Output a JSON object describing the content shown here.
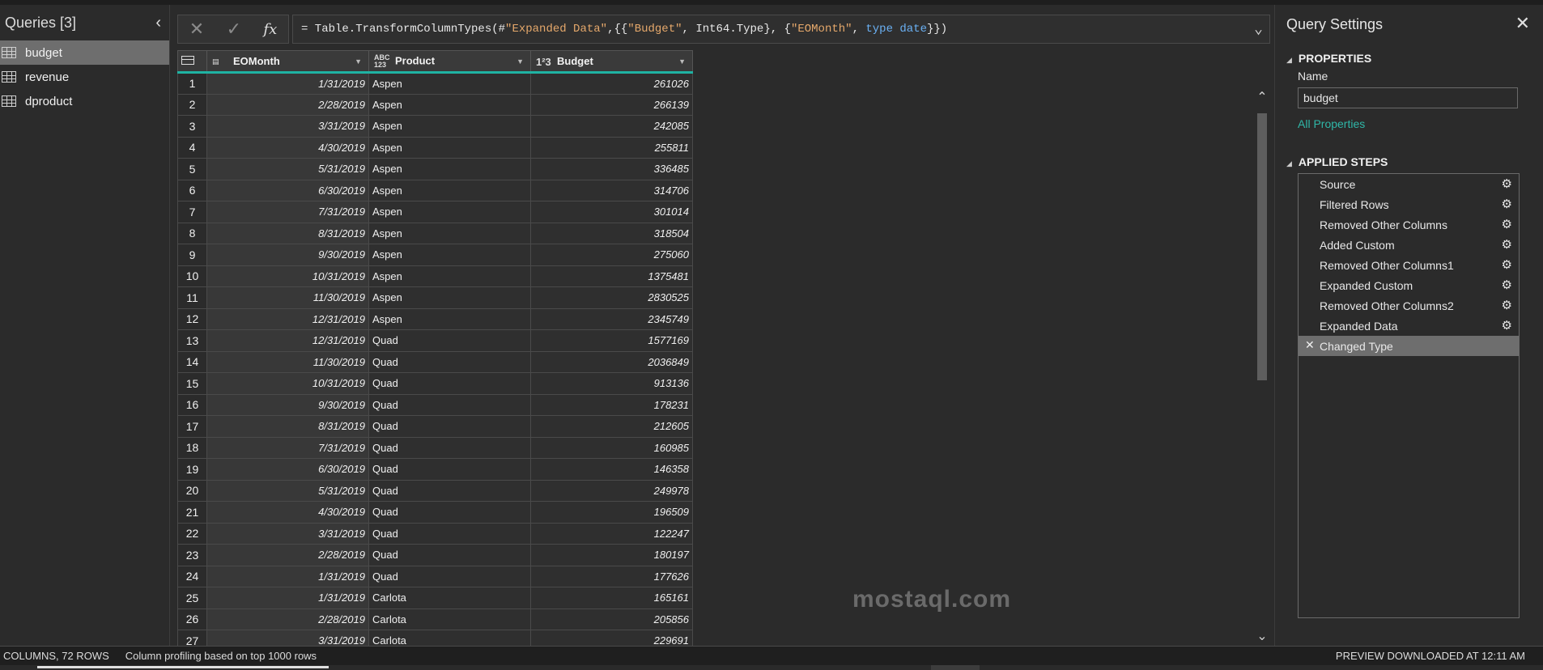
{
  "queries_panel": {
    "title": "Queries [3]",
    "items": [
      {
        "label": "budget",
        "selected": true
      },
      {
        "label": "revenue",
        "selected": false
      },
      {
        "label": "dproduct",
        "selected": false
      }
    ]
  },
  "formula_bar": {
    "prefix": "= Table.TransformColumnTypes(#",
    "s1": "\"Expanded Data\"",
    "p2": ",{{",
    "s2": "\"Budget\"",
    "p3": ", Int64.Type}, {",
    "s3": "\"EOMonth\"",
    "p4": ", ",
    "k1": "type date",
    "p5": "}})",
    "fx_label": "fx"
  },
  "table": {
    "columns": [
      {
        "name": "EOMonth",
        "type_icon": "calendar-icon"
      },
      {
        "name": "Product",
        "type_icon": "ABC 123"
      },
      {
        "name": "Budget",
        "type_icon": "1²3"
      }
    ],
    "rows": [
      [
        "1",
        "1/31/2019",
        "Aspen",
        "261026"
      ],
      [
        "2",
        "2/28/2019",
        "Aspen",
        "266139"
      ],
      [
        "3",
        "3/31/2019",
        "Aspen",
        "242085"
      ],
      [
        "4",
        "4/30/2019",
        "Aspen",
        "255811"
      ],
      [
        "5",
        "5/31/2019",
        "Aspen",
        "336485"
      ],
      [
        "6",
        "6/30/2019",
        "Aspen",
        "314706"
      ],
      [
        "7",
        "7/31/2019",
        "Aspen",
        "301014"
      ],
      [
        "8",
        "8/31/2019",
        "Aspen",
        "318504"
      ],
      [
        "9",
        "9/30/2019",
        "Aspen",
        "275060"
      ],
      [
        "10",
        "10/31/2019",
        "Aspen",
        "1375481"
      ],
      [
        "11",
        "11/30/2019",
        "Aspen",
        "2830525"
      ],
      [
        "12",
        "12/31/2019",
        "Aspen",
        "2345749"
      ],
      [
        "13",
        "12/31/2019",
        "Quad",
        "1577169"
      ],
      [
        "14",
        "11/30/2019",
        "Quad",
        "2036849"
      ],
      [
        "15",
        "10/31/2019",
        "Quad",
        "913136"
      ],
      [
        "16",
        "9/30/2019",
        "Quad",
        "178231"
      ],
      [
        "17",
        "8/31/2019",
        "Quad",
        "212605"
      ],
      [
        "18",
        "7/31/2019",
        "Quad",
        "160985"
      ],
      [
        "19",
        "6/30/2019",
        "Quad",
        "146358"
      ],
      [
        "20",
        "5/31/2019",
        "Quad",
        "249978"
      ],
      [
        "21",
        "4/30/2019",
        "Quad",
        "196509"
      ],
      [
        "22",
        "3/31/2019",
        "Quad",
        "122247"
      ],
      [
        "23",
        "2/28/2019",
        "Quad",
        "180197"
      ],
      [
        "24",
        "1/31/2019",
        "Quad",
        "177626"
      ],
      [
        "25",
        "1/31/2019",
        "Carlota",
        "165161"
      ],
      [
        "26",
        "2/28/2019",
        "Carlota",
        "205856"
      ],
      [
        "27",
        "3/31/2019",
        "Carlota",
        "229691"
      ]
    ]
  },
  "settings": {
    "title": "Query Settings",
    "properties_label": "PROPERTIES",
    "name_label": "Name",
    "name_value": "budget",
    "all_properties": "All Properties",
    "applied_steps_label": "APPLIED STEPS",
    "steps": [
      {
        "label": "Source",
        "selected": false
      },
      {
        "label": "Filtered Rows",
        "selected": false
      },
      {
        "label": "Removed Other Columns",
        "selected": false
      },
      {
        "label": "Added Custom",
        "selected": false
      },
      {
        "label": "Removed Other Columns1",
        "selected": false
      },
      {
        "label": "Expanded Custom",
        "selected": false
      },
      {
        "label": "Removed Other Columns2",
        "selected": false
      },
      {
        "label": "Expanded Data",
        "selected": false
      },
      {
        "label": "Changed Type",
        "selected": true
      }
    ]
  },
  "status_bar": {
    "columns_rows": "COLUMNS, 72 ROWS",
    "profiling": "Column profiling based on top 1000 rows",
    "preview": "PREVIEW DOWNLOADED AT 12:11 AM"
  },
  "watermark": "mostaql.com"
}
